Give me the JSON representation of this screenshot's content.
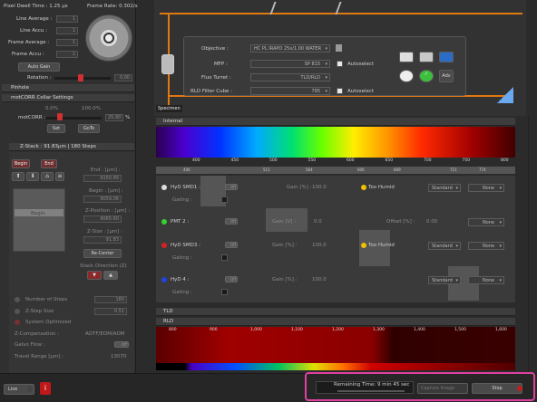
{
  "left": {
    "pixel_dwell": "Pixel Dwell Time : 1.25 µs",
    "frame_rate": "Frame Rate: 0.302/s",
    "line_average_label": "Line Average :",
    "line_average": "1",
    "line_accu_label": "Line Accu :",
    "line_accu": "1",
    "frame_average_label": "Frame Average :",
    "frame_average": "1",
    "frame_accu_label": "Frame Accu :",
    "frame_accu": "1",
    "auto_gain": "Auto Gain",
    "rotation_label": "Rotation :",
    "rotation_value": "0.00",
    "pinhole": "Pinhole",
    "motcorr_settings": "motCORR Collar Settings",
    "motcorr_min": "0.0%",
    "motcorr_max": "100.0%",
    "motcorr_label": "motCORR :",
    "motcorr_value": "25.80",
    "motcorr_unit": "%",
    "motcorr_fraction": 0.258,
    "set": "Set",
    "goto": "GoTo",
    "zstack_title": "Z-Stack : 91.83µm | 180 Steps",
    "begin": "Begin",
    "end": "End",
    "end_label": "End : [µm] :",
    "end_value": "9150.89",
    "begin_label": "Begin : [µm] :",
    "begin_value": "9059.06",
    "zpos_label": "Z-Position : [µm] :",
    "zpos_value": "9065.60",
    "zsize_label": "Z-Size : [µm] :",
    "zsize_value": "91.83",
    "recenter": "Re-Center",
    "stack_dir": "Stack Direction (Z)",
    "slider_label": "Begin",
    "num_steps_label": "Number of Steps",
    "num_steps": "180",
    "zstep_label": "Z-Step Size",
    "zstep": "0.51",
    "sys_opt": "System Optimized",
    "zcomp_label": "Z-Compensation :",
    "zcomp": "AOTF/EOM/AOM",
    "galvo_label": "Galvo Flow :",
    "galvo": "Off",
    "travel_label": "Travel Range [µm] :",
    "travel": "13070"
  },
  "optics": {
    "objective_label": "Objective :",
    "objective": "HC PL IRAPO  25x/1.00 WATER",
    "mfp_label": "MFP :",
    "mfp": "SP 815",
    "fluo_label": "Fluo Turret :",
    "fluo": "TLD/RLD",
    "rld_label": "RLD Filter Cube :",
    "rld": "795",
    "autoselect": "Autoselect",
    "specimen": "Specimen",
    "adv": "Adv"
  },
  "internal": {
    "title": "Internal",
    "ticks": [
      "400",
      "450",
      "500",
      "550",
      "600",
      "650",
      "700",
      "750",
      "800"
    ],
    "markers": [
      "406",
      "511",
      "564",
      "606",
      "669",
      "721",
      "774"
    ]
  },
  "detectors": [
    {
      "name": "HyD SMD1 :",
      "state": "Off",
      "gain_label": "Gain [%] :",
      "gain": "100.0",
      "status": "Too Humid",
      "mode": "Standard",
      "lut": "None",
      "gating": "Gating :",
      "color": "#d8d8d8"
    },
    {
      "name": "PMT 2 :",
      "state": "Off",
      "gain_label": "Gain [V] :",
      "gain": "0.0",
      "offset_label": "Offset [%] :",
      "offset": "0.00",
      "mode": "",
      "lut": "None",
      "color": "#35d22e"
    },
    {
      "name": "HyD SMD3 :",
      "state": "Off",
      "gain_label": "Gain [%] :",
      "gain": "100.0",
      "status": "Too Humid",
      "mode": "Standard",
      "lut": "None",
      "gating": "Gating :",
      "color": "#d42222"
    },
    {
      "name": "HyD 4 :",
      "state": "Off",
      "gain_label": "Gain [%] :",
      "gain": "100.0",
      "mode": "Standard",
      "lut": "None",
      "gating": "Gating :",
      "color": "#2244dd"
    }
  ],
  "tld": "TLD",
  "rld": {
    "title": "RLD",
    "ticks": [
      "800",
      "900",
      "1,000",
      "1,100",
      "1,200",
      "1,300",
      "1,400",
      "1,500",
      "1,600"
    ]
  },
  "bottom": {
    "live": "Live",
    "remaining": "Remaining Time: 9 min 45 sec",
    "capture": "Capture Image",
    "stop": "Stop"
  }
}
